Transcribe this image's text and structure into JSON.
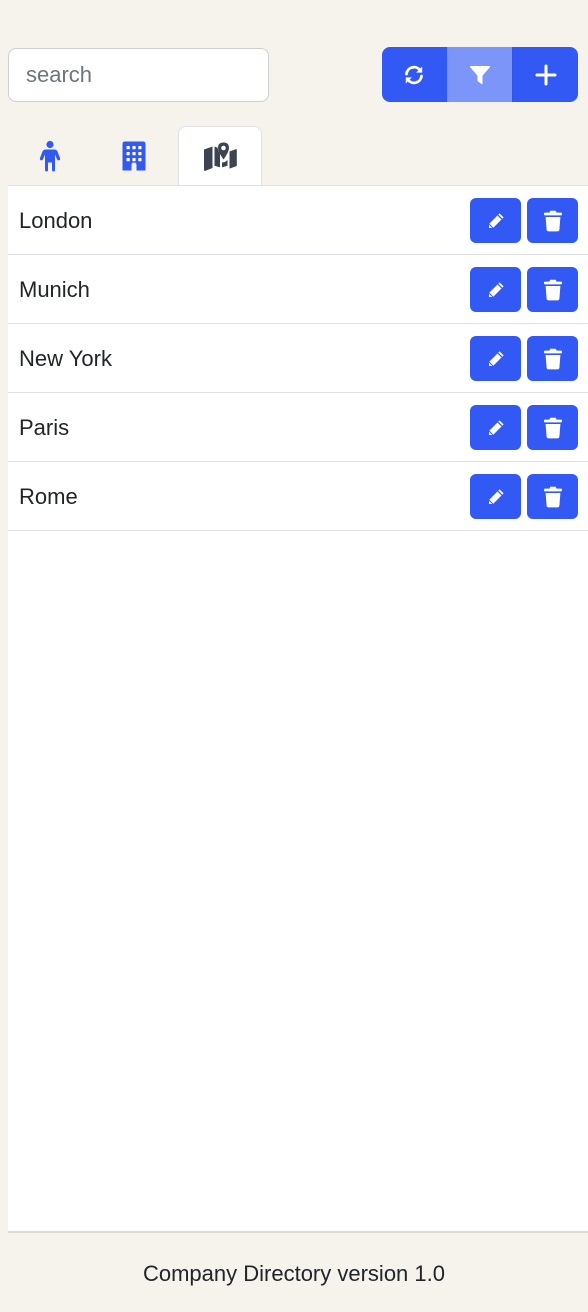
{
  "search": {
    "placeholder": "search",
    "value": ""
  },
  "toolbar": {
    "buttons": [
      {
        "icon": "refresh-icon",
        "active": false
      },
      {
        "icon": "filter-icon",
        "active": true
      },
      {
        "icon": "plus-icon",
        "active": false
      }
    ]
  },
  "tabs": [
    {
      "icon": "person-icon",
      "active": false
    },
    {
      "icon": "building-icon",
      "active": false
    },
    {
      "icon": "map-location-icon",
      "active": true
    }
  ],
  "locations": [
    {
      "name": "London"
    },
    {
      "name": "Munich"
    },
    {
      "name": "New York"
    },
    {
      "name": "Paris"
    },
    {
      "name": "Rome"
    }
  ],
  "footer": {
    "text": "Company Directory version 1.0"
  },
  "colors": {
    "accent": "#3359f5",
    "accent_active": "#7b95f8",
    "page_background": "#f6f3ec",
    "panel_background": "#ffffff",
    "active_tab_icon": "#3d4451"
  }
}
